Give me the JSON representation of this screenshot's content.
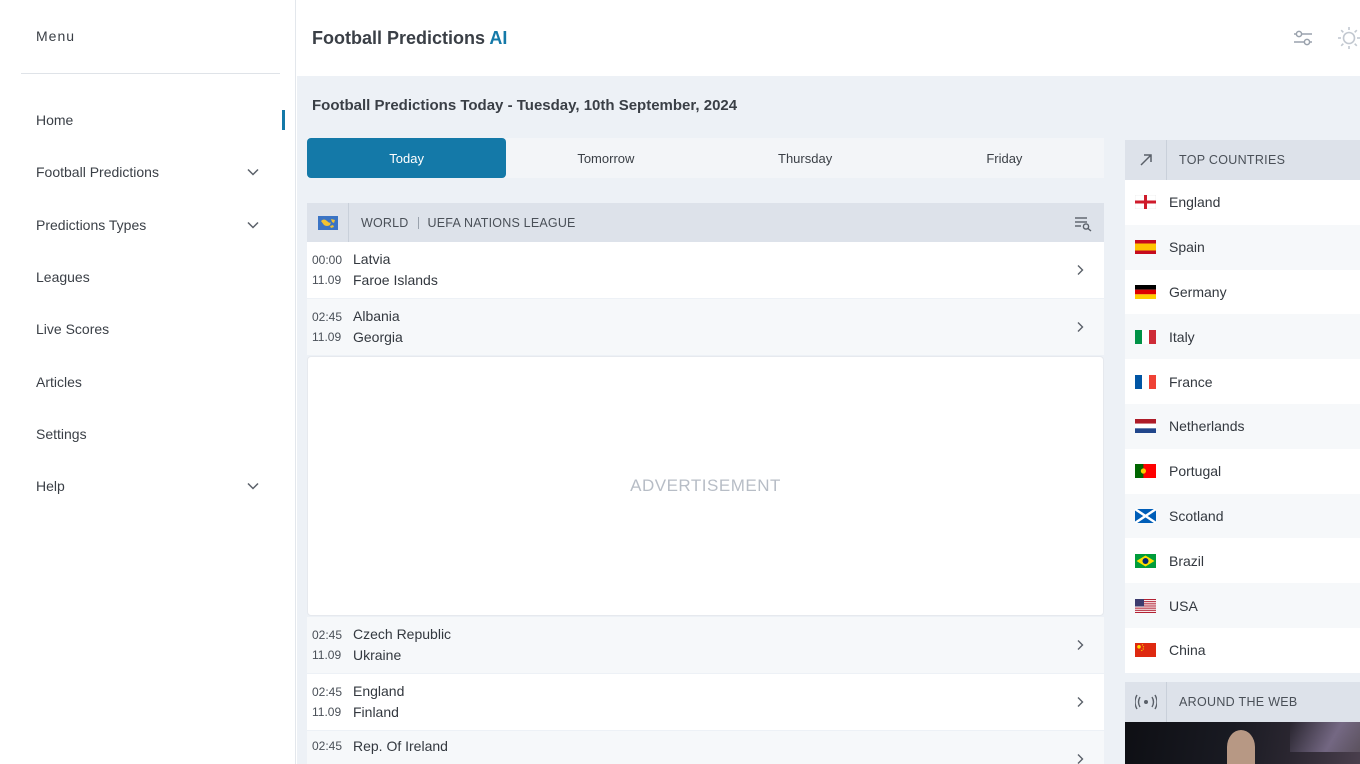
{
  "sidebar": {
    "menu_title": "Menu",
    "items": [
      {
        "label": "Home",
        "active": true,
        "has_children": false
      },
      {
        "label": "Football Predictions",
        "active": false,
        "has_children": true
      },
      {
        "label": "Predictions Types",
        "active": false,
        "has_children": true
      },
      {
        "label": "Leagues",
        "active": false,
        "has_children": false
      },
      {
        "label": "Live Scores",
        "active": false,
        "has_children": false
      },
      {
        "label": "Articles",
        "active": false,
        "has_children": false
      },
      {
        "label": "Settings",
        "active": false,
        "has_children": false
      },
      {
        "label": "Help",
        "active": false,
        "has_children": true
      }
    ]
  },
  "header": {
    "brand": "Football Predictions",
    "brand_accent": "AI",
    "icons": [
      "settings-sliders-icon",
      "theme-sun-icon"
    ]
  },
  "main": {
    "page_title": "Football Predictions Today - Tuesday, 10th September, 2024",
    "tabs": [
      {
        "label": "Today",
        "active": true
      },
      {
        "label": "Tomorrow",
        "active": false
      },
      {
        "label": "Thursday",
        "active": false
      },
      {
        "label": "Friday",
        "active": false
      }
    ],
    "league": {
      "region": "WORLD",
      "name": "UEFA NATIONS LEAGUE",
      "flag_icon": "world-flag-icon"
    },
    "matches_before_ad": [
      {
        "time": "00:00",
        "date": "11.09",
        "home": "Latvia",
        "away": "Faroe Islands"
      },
      {
        "time": "02:45",
        "date": "11.09",
        "home": "Albania",
        "away": "Georgia"
      }
    ],
    "advertisement": "ADVERTISEMENT",
    "matches_after_ad": [
      {
        "time": "02:45",
        "date": "11.09",
        "home": "Czech Republic",
        "away": "Ukraine"
      },
      {
        "time": "02:45",
        "date": "11.09",
        "home": "England",
        "away": "Finland"
      },
      {
        "time": "02:45",
        "date": "11.09",
        "home": "Rep. Of Ireland",
        "away": ""
      }
    ]
  },
  "right_panel": {
    "top_countries_title": "TOP COUNTRIES",
    "countries": [
      {
        "name": "England",
        "flag": "england-flag-icon"
      },
      {
        "name": "Spain",
        "flag": "spain-flag-icon"
      },
      {
        "name": "Germany",
        "flag": "germany-flag-icon"
      },
      {
        "name": "Italy",
        "flag": "italy-flag-icon"
      },
      {
        "name": "France",
        "flag": "france-flag-icon"
      },
      {
        "name": "Netherlands",
        "flag": "netherlands-flag-icon"
      },
      {
        "name": "Portugal",
        "flag": "portugal-flag-icon"
      },
      {
        "name": "Scotland",
        "flag": "scotland-flag-icon"
      },
      {
        "name": "Brazil",
        "flag": "brazil-flag-icon"
      },
      {
        "name": "USA",
        "flag": "usa-flag-icon"
      },
      {
        "name": "China",
        "flag": "china-flag-icon"
      }
    ],
    "around_web_title": "AROUND THE WEB"
  },
  "colors": {
    "accent": "#1479a8",
    "background": "#edf1f6",
    "header_strip": "#dde2ea"
  }
}
